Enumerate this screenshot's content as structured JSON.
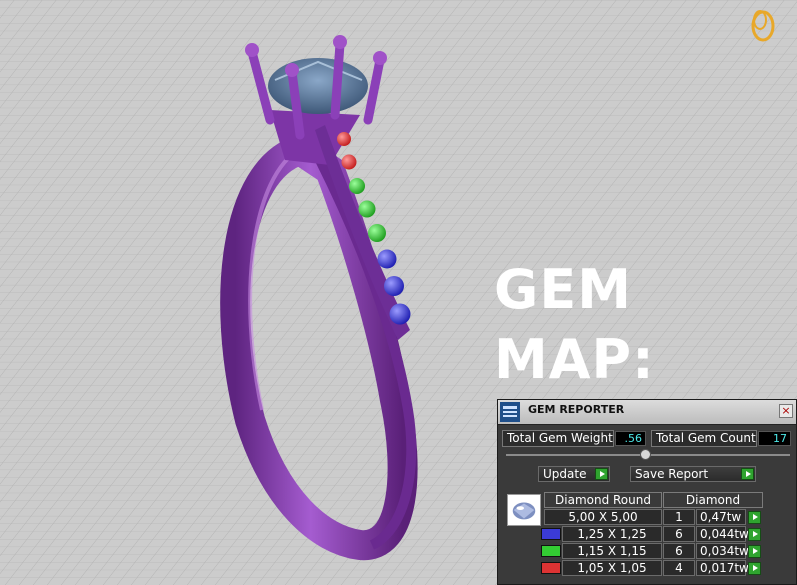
{
  "overlay": {
    "line1": "GEM",
    "line2": "MAP:"
  },
  "panel": {
    "title": "GEM REPORTER",
    "close_glyph": "×",
    "total_weight_label": "Total Gem Weight",
    "total_weight_value": ".56",
    "total_count_label": "Total Gem Count",
    "total_count_value": "17",
    "update_label": "Update",
    "save_label": "Save Report",
    "table": {
      "col_shape": "Diamond Round",
      "col_material": "Diamond",
      "rows": [
        {
          "size": "5,00 X 5,00",
          "count": "1",
          "weight": "0,47tw",
          "color": ""
        },
        {
          "size": "1,25 X 1,25",
          "count": "6",
          "weight": "0,044tw",
          "color": "#3b3bd6"
        },
        {
          "size": "1,15 X 1,15",
          "count": "6",
          "weight": "0,034tw",
          "color": "#33cc33"
        },
        {
          "size": "1,05 X 1,05",
          "count": "4",
          "weight": "0,017tw",
          "color": "#dd3333"
        }
      ]
    }
  },
  "colors": {
    "ring_metal": "#8a3fb0",
    "center_stone": "#5d7fa6",
    "accent_play": "#2fa42f",
    "value_text": "#4de8e8"
  },
  "icons": {
    "logo": "gold-ring-logo-icon",
    "app": "gem-reporter-app-icon",
    "close": "close-icon",
    "play": "play-arrow-icon"
  }
}
